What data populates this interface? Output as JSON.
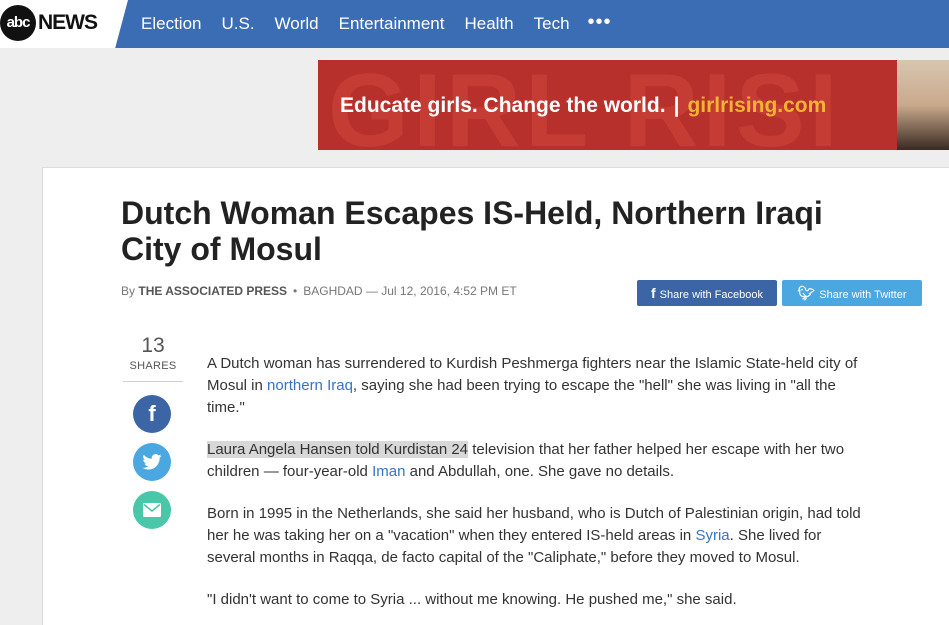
{
  "header": {
    "logo_abc": "abc",
    "logo_news": "NEWS",
    "nav": [
      "Election",
      "U.S.",
      "World",
      "Entertainment",
      "Health",
      "Tech"
    ],
    "more": "•••"
  },
  "ad": {
    "bg_text": "GIRL RISI",
    "slogan": "Educate girls. Change the world.",
    "separator": "|",
    "site": "girlrising.com"
  },
  "article": {
    "title": "Dutch Woman Escapes IS-Held, Northern Iraqi City of Mosul",
    "byline": {
      "by": "By",
      "author": "THE ASSOCIATED PRESS",
      "dot": "•",
      "dateline": "BAGHDAD — Jul 12, 2016, 4:52 PM ET"
    },
    "share_buttons": {
      "facebook": "Share with Facebook",
      "twitter": "Share with Twitter"
    },
    "shares": {
      "count": "13",
      "label": "SHARES"
    },
    "paragraphs": {
      "p1_a": "A Dutch woman has surrendered to Kurdish Peshmerga fighters near the Islamic State-held city of Mosul in ",
      "p1_link": "northern Iraq",
      "p1_b": ", saying she had been trying to escape the \"hell\" she was living in \"all the time.\"",
      "p2_highlight": "Laura Angela Hansen told Kurdistan 24",
      "p2_a": " television that her father helped her escape with her two children — four-year-old ",
      "p2_link": "Iman",
      "p2_b": " and Abdullah, one. She gave no details.",
      "p3_a": "Born in 1995 in the Netherlands, she said her husband, who is Dutch of Palestinian origin, had told her he was taking her on a \"vacation\" when they entered IS-held areas in ",
      "p3_link": "Syria",
      "p3_b": ". She lived for several months in Raqqa, de facto capital of the \"Caliphate,\" before they moved to Mosul.",
      "p4": "\"I didn't want to come to Syria ... without me knowing. He pushed me,\" she said."
    }
  },
  "colors": {
    "nav_bg": "#3b6db5",
    "facebook": "#3b65a5",
    "twitter": "#4ba7e0",
    "email": "#4ac6a8",
    "link": "#3b72c4"
  }
}
